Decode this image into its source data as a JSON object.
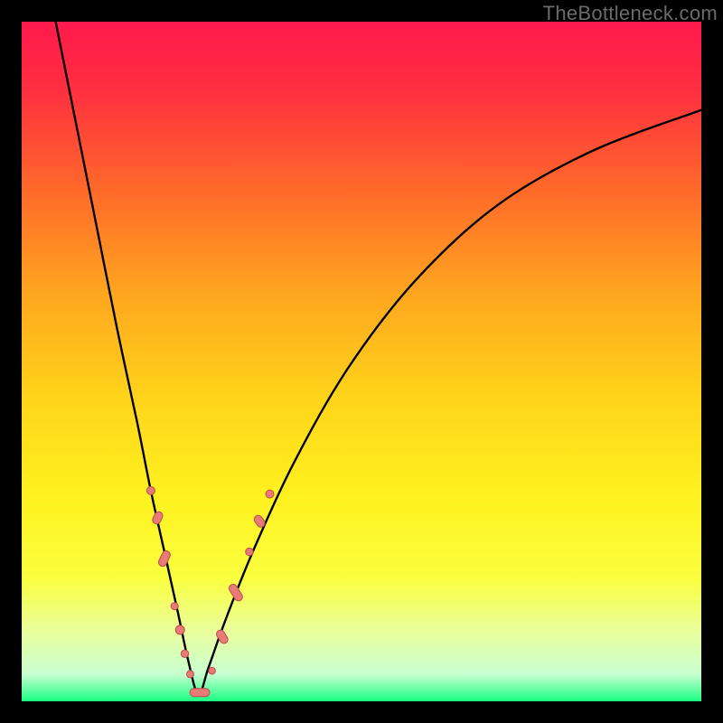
{
  "watermark": "TheBottleneck.com",
  "gradient": {
    "stops": [
      {
        "offset": 0.0,
        "color": "#ff1a4d"
      },
      {
        "offset": 0.1,
        "color": "#ff2f3f"
      },
      {
        "offset": 0.25,
        "color": "#ff6a2a"
      },
      {
        "offset": 0.4,
        "color": "#ffa61f"
      },
      {
        "offset": 0.55,
        "color": "#ffd31a"
      },
      {
        "offset": 0.7,
        "color": "#fff21f"
      },
      {
        "offset": 0.82,
        "color": "#faff40"
      },
      {
        "offset": 0.9,
        "color": "#e9ffa0"
      },
      {
        "offset": 0.96,
        "color": "#c8ffd0"
      },
      {
        "offset": 1.0,
        "color": "#1aff83"
      }
    ]
  },
  "chart_data": {
    "type": "line",
    "title": "",
    "xlabel": "",
    "ylabel": "",
    "xlim": [
      0,
      100
    ],
    "ylim": [
      0,
      100
    ],
    "series": [
      {
        "name": "bottleneck-curve",
        "x": [
          5,
          8,
          11,
          14,
          17,
          19,
          21,
          23,
          24.5,
          26,
          27.5,
          30,
          34,
          40,
          48,
          58,
          70,
          84,
          100
        ],
        "y": [
          100,
          85,
          70,
          55,
          41,
          31,
          22,
          13,
          6,
          1,
          5,
          12,
          22,
          35,
          49,
          62,
          73,
          81,
          87
        ]
      }
    ],
    "markers": [
      {
        "x": 19.0,
        "y": 31.0,
        "shape": "dot",
        "r": 4.5
      },
      {
        "x": 20.0,
        "y": 27.0,
        "shape": "pill",
        "len": 14,
        "angle": -64
      },
      {
        "x": 21.0,
        "y": 21.0,
        "shape": "pill",
        "len": 18,
        "angle": -64
      },
      {
        "x": 22.5,
        "y": 14.0,
        "shape": "dot",
        "r": 4.0
      },
      {
        "x": 23.3,
        "y": 10.5,
        "shape": "dot",
        "r": 5.0
      },
      {
        "x": 24.0,
        "y": 7.0,
        "shape": "dot",
        "r": 4.2
      },
      {
        "x": 24.8,
        "y": 4.0,
        "shape": "dot",
        "r": 4.0
      },
      {
        "x": 26.2,
        "y": 1.3,
        "shape": "pill",
        "len": 22,
        "angle": 0
      },
      {
        "x": 28.0,
        "y": 4.5,
        "shape": "dot",
        "r": 3.8
      },
      {
        "x": 29.5,
        "y": 9.5,
        "shape": "pill",
        "len": 16,
        "angle": 58
      },
      {
        "x": 31.5,
        "y": 16.0,
        "shape": "pill",
        "len": 20,
        "angle": 58
      },
      {
        "x": 33.5,
        "y": 22.0,
        "shape": "dot",
        "r": 4.2
      },
      {
        "x": 35.0,
        "y": 26.5,
        "shape": "pill",
        "len": 14,
        "angle": 55
      },
      {
        "x": 36.5,
        "y": 30.5,
        "shape": "dot",
        "r": 4.5
      }
    ],
    "marker_fill": "#e87a77",
    "marker_stroke": "#b84f4c",
    "curve_color": "#000000"
  }
}
